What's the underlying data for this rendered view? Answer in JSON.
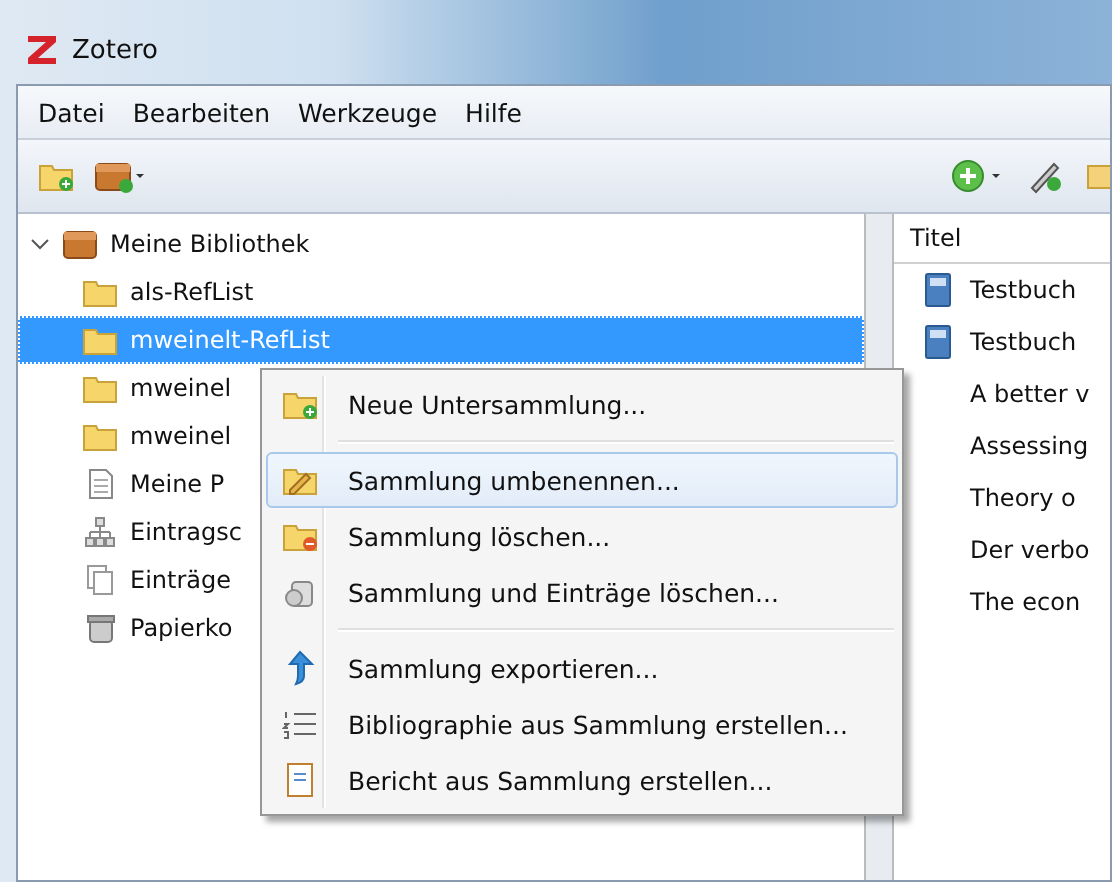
{
  "window": {
    "title": "Zotero"
  },
  "menu_bar": [
    "Datei",
    "Bearbeiten",
    "Werkzeuge",
    "Hilfe"
  ],
  "library": {
    "label": "Meine Bibliothek",
    "expanded": true,
    "children": [
      {
        "label": "als-RefList",
        "kind": "folder",
        "selected": false
      },
      {
        "label": "mweinelt-RefList",
        "kind": "folder",
        "selected": true
      },
      {
        "label": "mweinel",
        "kind": "folder",
        "selected": false
      },
      {
        "label": "mweinel",
        "kind": "folder",
        "selected": false
      },
      {
        "label": "Meine P",
        "kind": "document",
        "selected": false
      },
      {
        "label": "Eintragsc",
        "kind": "tree",
        "selected": false
      },
      {
        "label": "Einträge",
        "kind": "copies",
        "selected": false
      },
      {
        "label": "Papierko",
        "kind": "trash",
        "selected": false
      }
    ]
  },
  "items": {
    "columns": [
      "Titel"
    ],
    "rows": [
      "Testbuch",
      "Testbuch",
      "A better v",
      "Assessing",
      "Theory o",
      "Der verbo",
      "The econ"
    ]
  },
  "context_menu": [
    {
      "kind": "item",
      "label": "Neue Untersammlung...",
      "selected": false
    },
    {
      "kind": "separator"
    },
    {
      "kind": "item",
      "label": "Sammlung umbenennen...",
      "selected": true
    },
    {
      "kind": "item",
      "label": "Sammlung löschen...",
      "selected": false
    },
    {
      "kind": "item",
      "label": "Sammlung und Einträge löschen...",
      "selected": false
    },
    {
      "kind": "separator"
    },
    {
      "kind": "item",
      "label": "Sammlung exportieren...",
      "selected": false
    },
    {
      "kind": "item",
      "label": "Bibliographie aus Sammlung erstellen...",
      "selected": false
    },
    {
      "kind": "item",
      "label": "Bericht aus Sammlung erstellen...",
      "selected": false
    }
  ]
}
